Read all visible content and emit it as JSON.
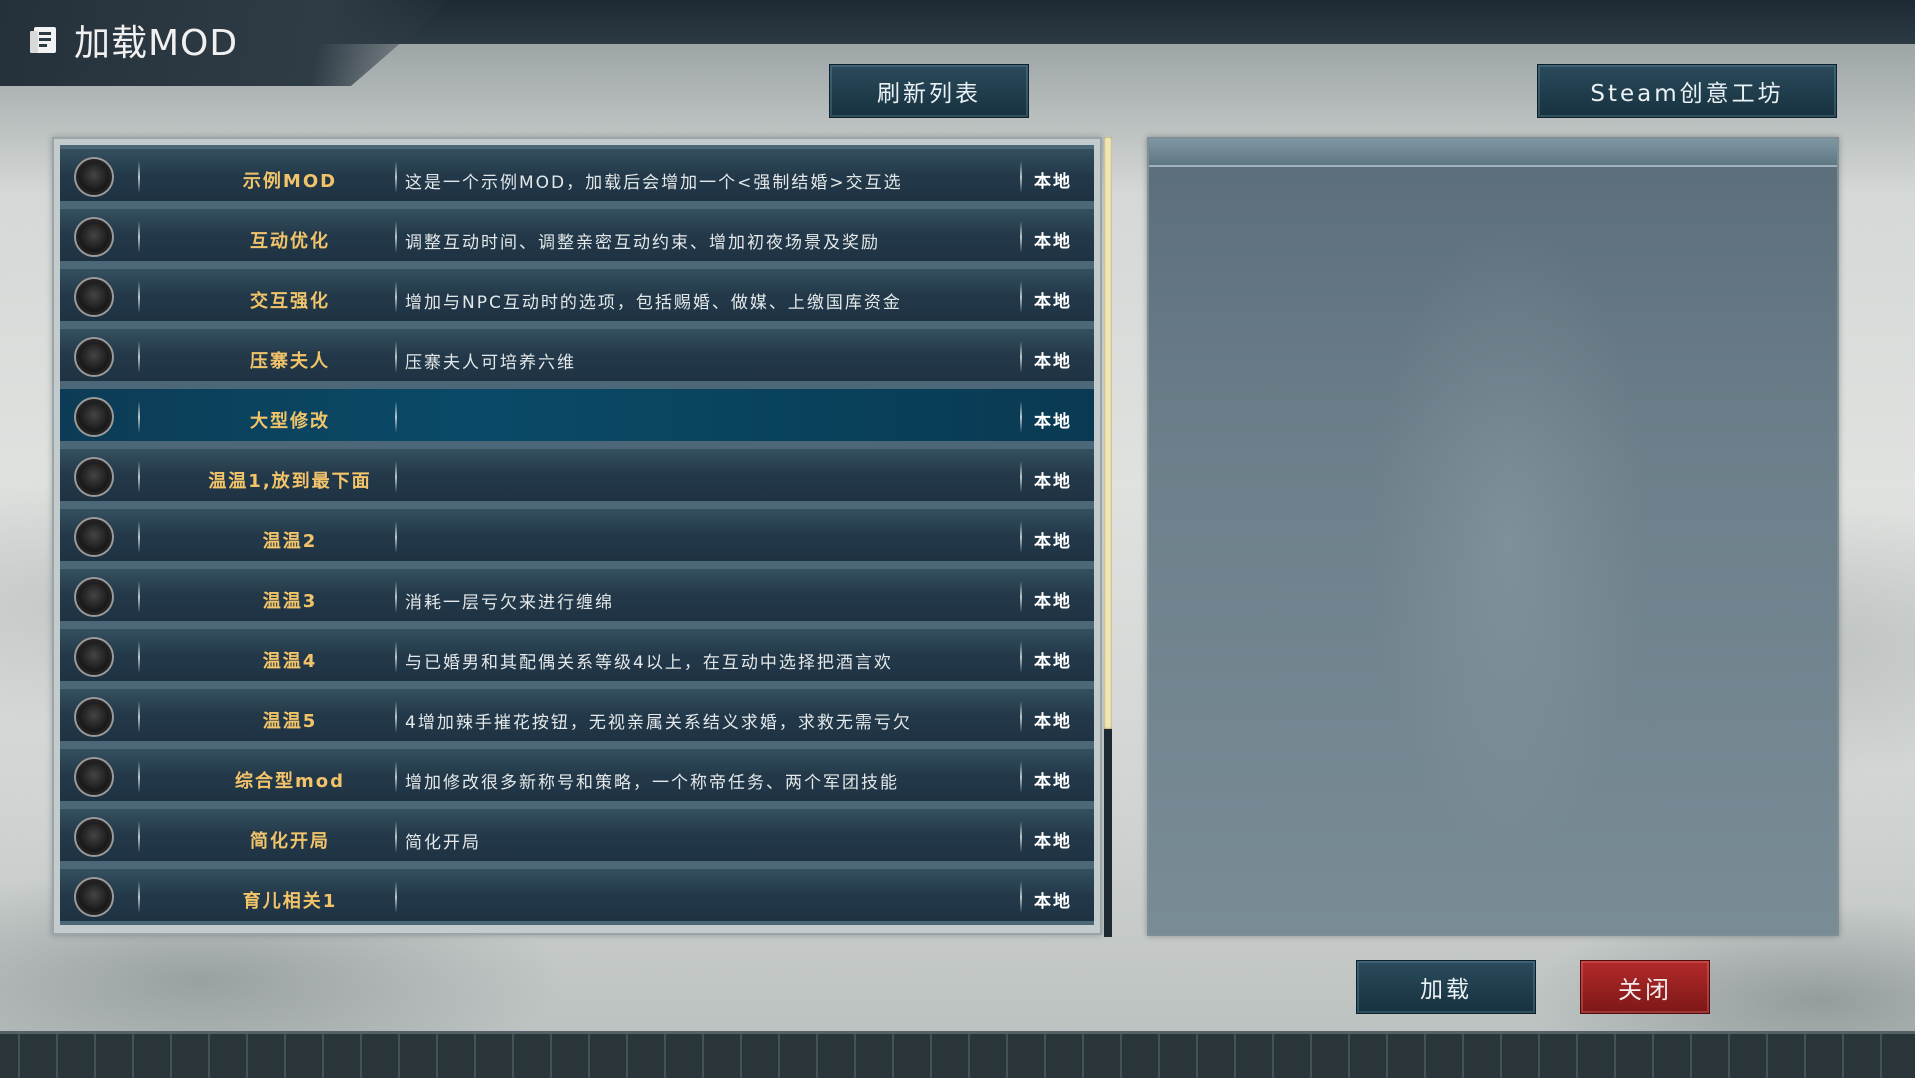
{
  "window": {
    "title": "加载MOD"
  },
  "toolbar": {
    "refresh_label": "刷新列表",
    "workshop_label": "Steam创意工坊"
  },
  "mods": [
    {
      "name": "示例MOD",
      "desc": "这是一个示例MOD，加载后会增加一个<强制结婚>交互选",
      "source": "本地"
    },
    {
      "name": "互动优化",
      "desc": "调整互动时间、调整亲密互动约束、增加初夜场景及奖励",
      "source": "本地"
    },
    {
      "name": "交互强化",
      "desc": "增加与NPC互动时的选项，包括赐婚、做媒、上缴国库资金",
      "source": "本地"
    },
    {
      "name": "压寨夫人",
      "desc": "压寨夫人可培养六维",
      "source": "本地"
    },
    {
      "name": "大型修改",
      "desc": "",
      "source": "本地"
    },
    {
      "name": "温温1,放到最下面",
      "desc": "",
      "source": "本地"
    },
    {
      "name": "温温2",
      "desc": "",
      "source": "本地"
    },
    {
      "name": "温温3",
      "desc": "消耗一层亏欠来进行缠绵",
      "source": "本地"
    },
    {
      "name": "温温4",
      "desc": "与已婚男和其配偶关系等级4以上，在互动中选择把酒言欢",
      "source": "本地"
    },
    {
      "name": "温温5",
      "desc": "4增加辣手摧花按钮，无视亲属关系结义求婚，求救无需亏欠",
      "source": "本地"
    },
    {
      "name": "综合型mod",
      "desc": "增加修改很多新称号和策略，一个称帝任务、两个军团技能",
      "source": "本地"
    },
    {
      "name": "简化开局",
      "desc": "简化开局",
      "source": "本地"
    },
    {
      "name": "育儿相关1",
      "desc": "",
      "source": "本地"
    }
  ],
  "selected_index": 4,
  "scrollbar": {
    "visible_fraction": 0.74
  },
  "actions": {
    "load_label": "加载",
    "close_label": "关闭"
  },
  "colors": {
    "accent_gold": "#f2c46a",
    "close_red": "#9b2121",
    "panel_blue": "#23394a"
  }
}
